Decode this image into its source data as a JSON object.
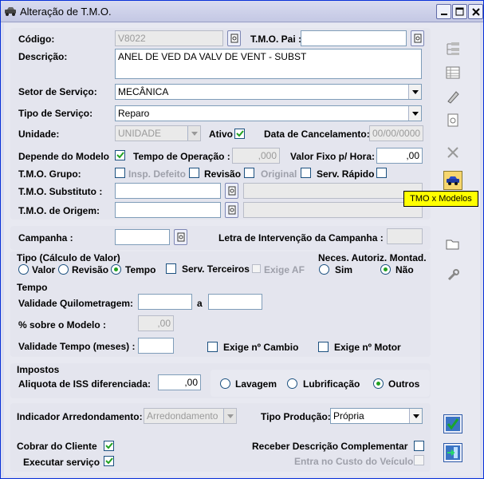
{
  "window": {
    "title": "Alteração de T.M.O."
  },
  "form": {
    "codigo": {
      "label": "Código:",
      "value": "V8022"
    },
    "tmo_pai": {
      "label": "T.M.O. Pai :",
      "value": ""
    },
    "descricao": {
      "label": "Descrição:",
      "value": "ANEL DE VED DA VALV DE VENT - SUBST"
    },
    "setor_servico": {
      "label": "Setor de Serviço:",
      "value": "MECÂNICA"
    },
    "tipo_servico": {
      "label": "Tipo de Serviço:",
      "value": "Reparo"
    },
    "unidade": {
      "label": "Unidade:",
      "value": "UNIDADE"
    },
    "ativo": {
      "label": "Ativo",
      "checked": true
    },
    "data_cancelamento": {
      "label": "Data de Cancelamento:",
      "value": "00/00/0000"
    },
    "depende_modelo": {
      "label": "Depende do Modelo",
      "checked": true
    },
    "tempo_operacao": {
      "label": "Tempo de Operação :",
      "value": ",000"
    },
    "valor_fixo": {
      "label": "Valor Fixo p/ Hora:",
      "value": ",00"
    },
    "tmo_grupo": {
      "label": "T.M.O. Grupo:"
    },
    "insp_defeito": {
      "label": "Insp. Defeito",
      "checked": false
    },
    "revisao": {
      "label": "Revisão",
      "checked": false
    },
    "original": {
      "label": "Original",
      "checked": false
    },
    "serv_rapido": {
      "label": "Serv. Rápido",
      "checked": false
    },
    "tmo_substituto": {
      "label": "T.M.O. Substituto :",
      "value": ""
    },
    "tmo_origem": {
      "label": "T.M.O. de Origem:",
      "value": ""
    },
    "campanha": {
      "label": "Campanha :",
      "value": ""
    },
    "letra_intervencao": {
      "label": "Letra de Intervenção da Campanha :",
      "value": ""
    },
    "tipo_calculo": {
      "label": "Tipo (Cálculo de Valor)",
      "options": [
        "Valor",
        "Revisão",
        "Tempo"
      ],
      "selected": "Tempo"
    },
    "serv_terceiros": {
      "label": "Serv. Terceiros",
      "checked": false
    },
    "exige_af": {
      "label": "Exige AF",
      "checked": false
    },
    "neces_autoriz": {
      "label": "Neces. Autoriz. Montad.",
      "options": [
        "Sim",
        "Não"
      ],
      "selected": "Não"
    },
    "tempo_section": {
      "label": "Tempo"
    },
    "validade_km": {
      "label": "Validade Quilometragem:",
      "from": "",
      "sep": "a",
      "to": ""
    },
    "perc_modelo": {
      "label": "% sobre o Modelo :",
      "value": ",00"
    },
    "validade_tempo": {
      "label": "Validade Tempo (meses) :",
      "value": ""
    },
    "exige_cambio": {
      "label": "Exige nº Cambio",
      "checked": false
    },
    "exige_motor": {
      "label": "Exige nº Motor",
      "checked": false
    },
    "impostos": {
      "label": "Impostos"
    },
    "aliquota_iss": {
      "label": "Aliquota de ISS diferenciada:",
      "value": ",00"
    },
    "categoria": {
      "options": [
        "Lavagem",
        "Lubrificação",
        "Outros"
      ],
      "selected": "Outros"
    },
    "indicador_arred": {
      "label": "Indicador Arredondamento:",
      "value": "Arredondamento"
    },
    "tipo_producao": {
      "label": "Tipo Produção:",
      "value": "Própria"
    },
    "cobrar_cliente": {
      "label": "Cobrar do Cliente",
      "checked": true
    },
    "executar_servico": {
      "label": "Executar serviço",
      "checked": true
    },
    "receber_descricao": {
      "label": "Receber Descrição Complementar",
      "checked": false
    },
    "entra_custo": {
      "label": "Entra no Custo do Veículo",
      "checked": false
    }
  },
  "tooltip": {
    "text": "TMO x Modelos"
  },
  "colors": {
    "title_bg": "#c4c8e4",
    "tooltip_bg": "#ffff00",
    "check_green": "#21a121",
    "active_icon_bg": "#f6d66e"
  }
}
